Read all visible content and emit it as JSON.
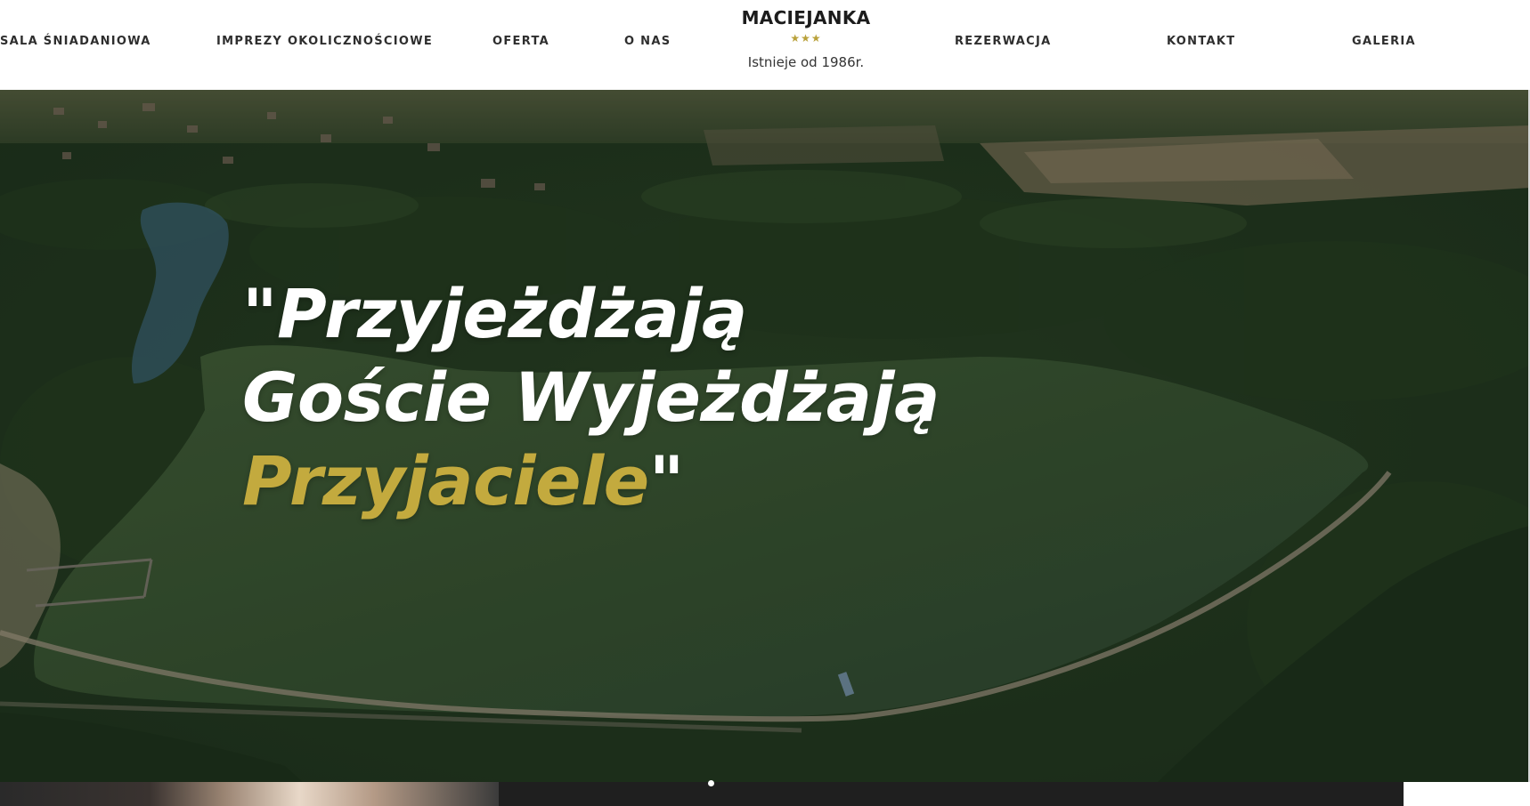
{
  "brand": {
    "name": "MACIEJANKA",
    "stars": "★★★",
    "tagline": "Istnieje od 1986r."
  },
  "nav": {
    "left": [
      "SALA ŚNIADANIOWA",
      "IMPREZY OKOLICZNOŚCIOWE",
      "OFERTA",
      "O NAS"
    ],
    "right": [
      "REZERWACJA",
      "KONTAKT",
      "GALERIA"
    ]
  },
  "hero": {
    "line1": "\"Przyjeżdżają",
    "line2": "Goście Wyjeżdżają",
    "line3_accent": "Przyjaciele",
    "line3_quote": "\""
  },
  "colors": {
    "accent": "#c3aa3e",
    "nav_text": "#2e2e2e",
    "hero_text": "#ffffff"
  }
}
